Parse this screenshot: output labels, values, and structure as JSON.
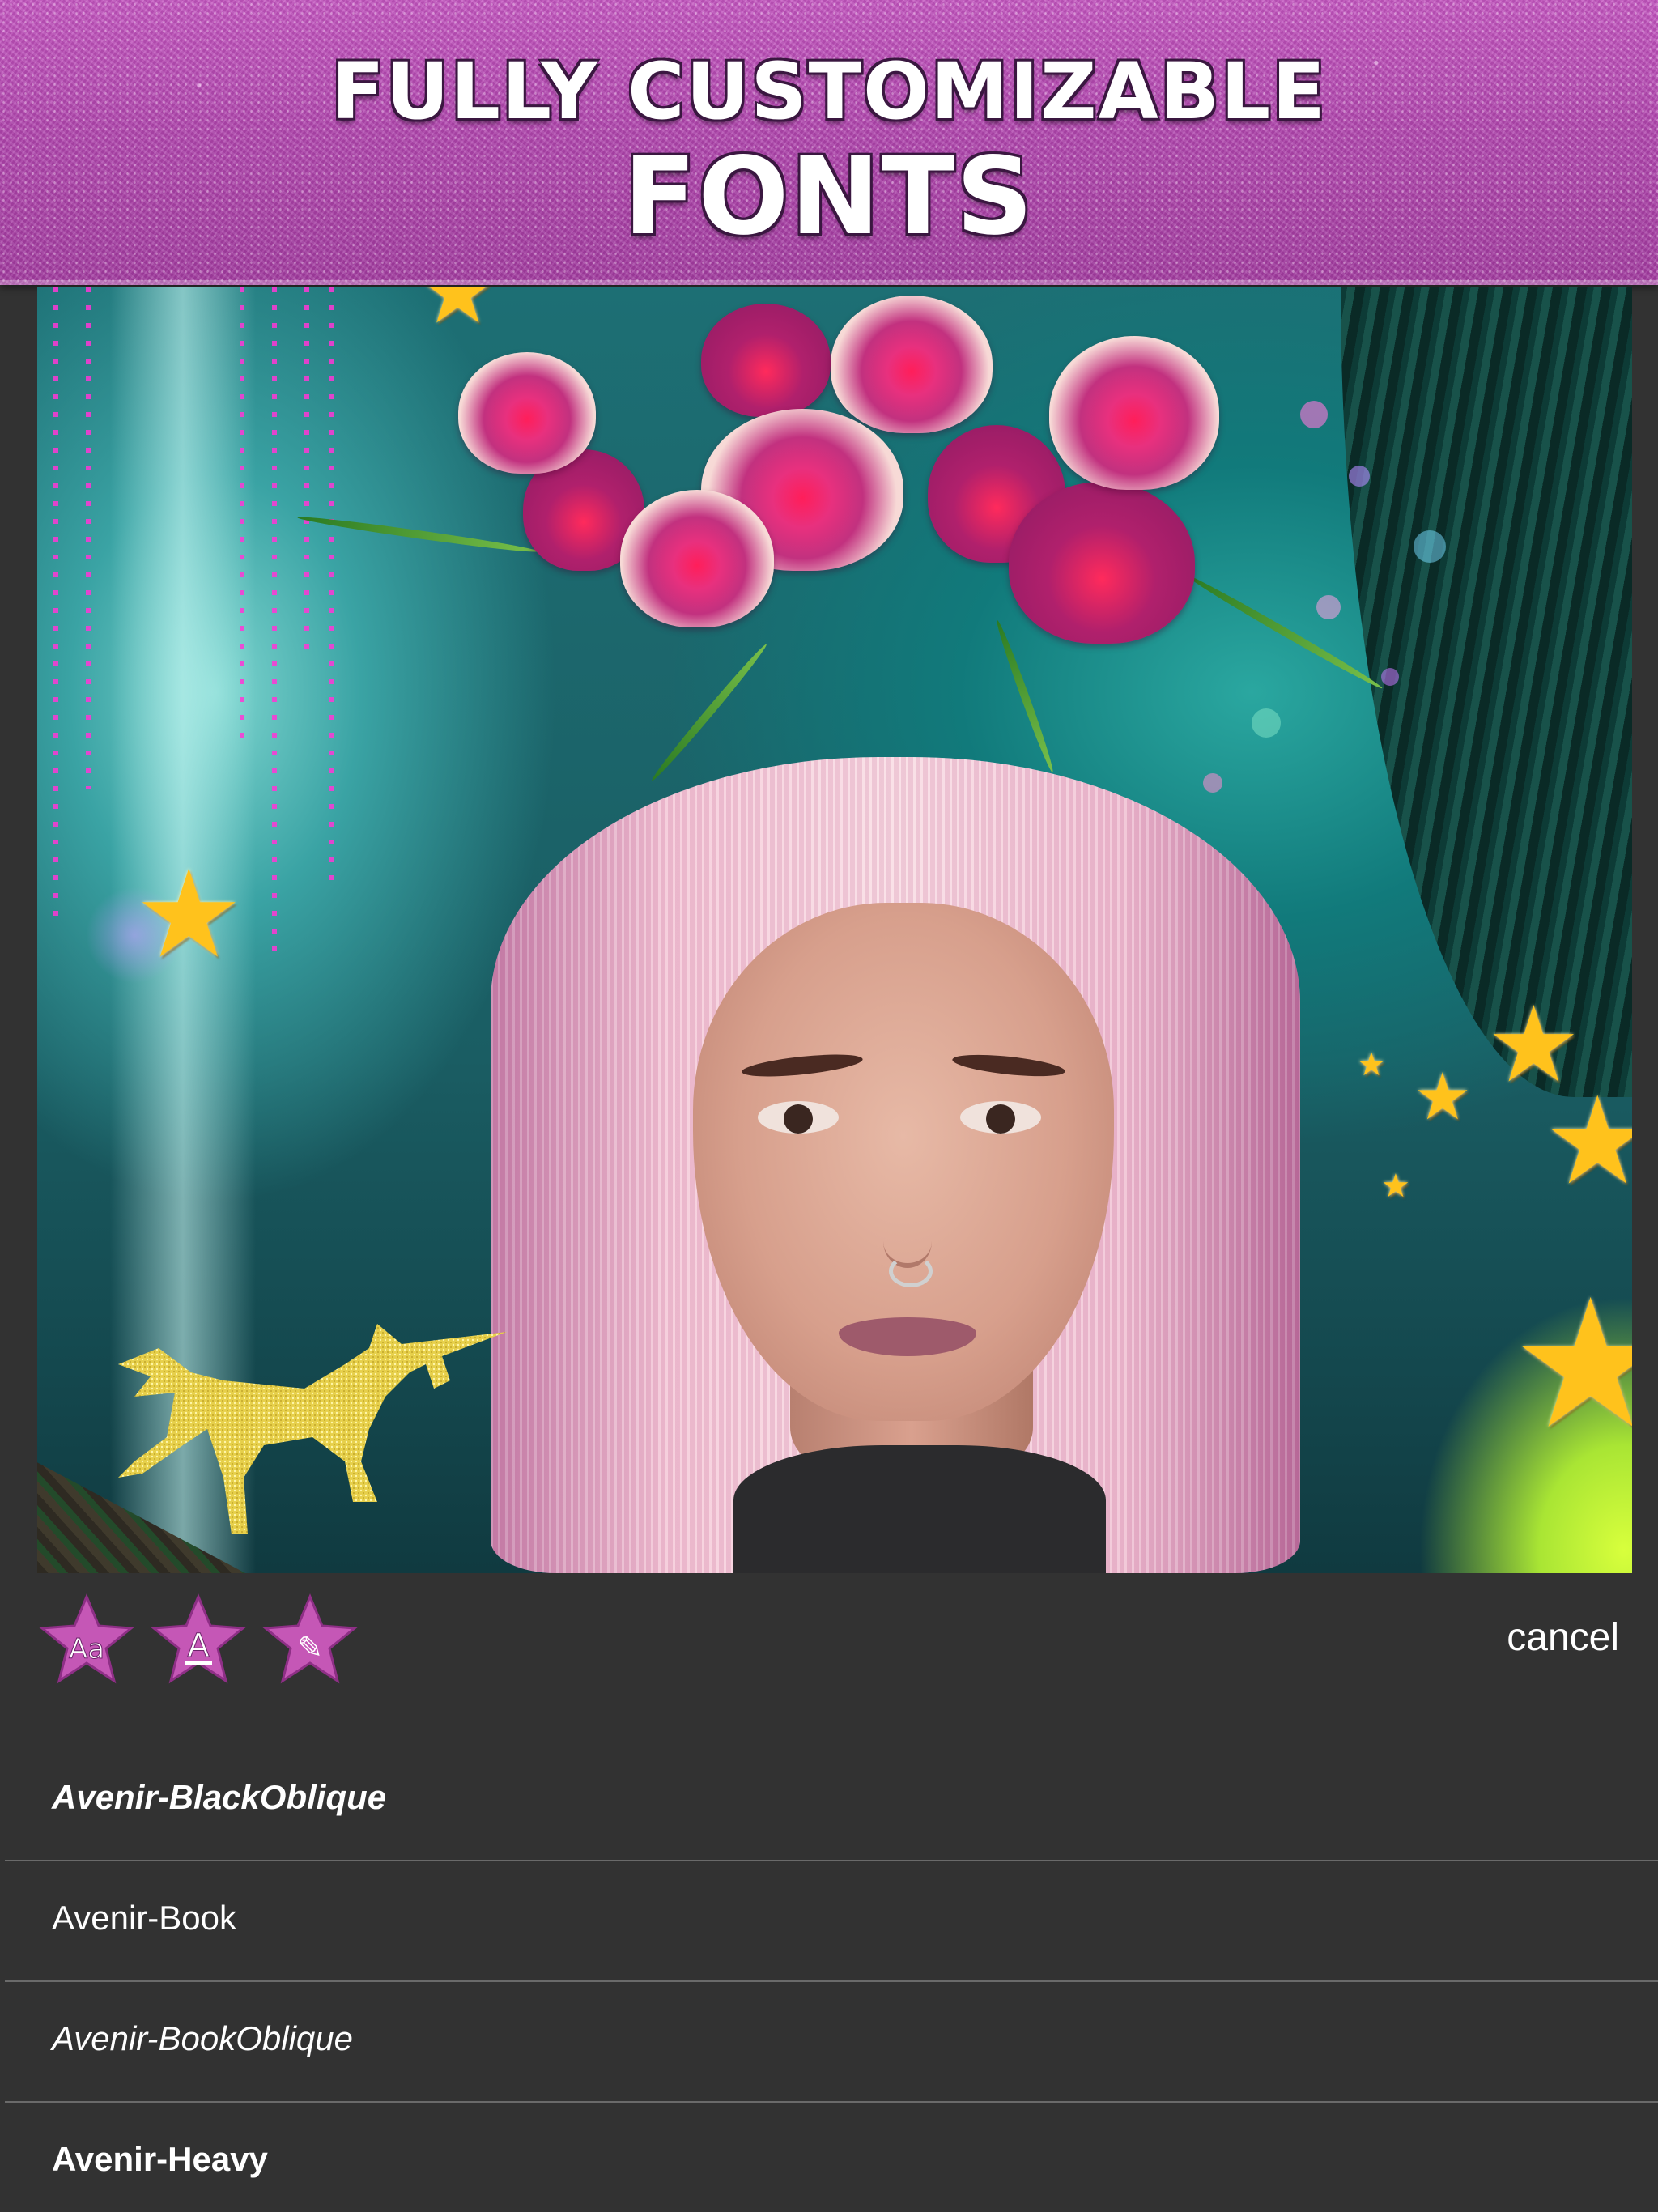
{
  "banner": {
    "line1": "FULLY CUSTOMIZABLE",
    "line2": "FONTS"
  },
  "colors": {
    "banner_purple": "#b04aae",
    "background": "#323232",
    "divider": "#6a6a6a",
    "text": "#ffffff",
    "tool_star": "#c557b6"
  },
  "toolbar": {
    "tools": [
      {
        "name": "font-style",
        "icon": "font-aa-star-icon",
        "glyph": "Aa"
      },
      {
        "name": "text-color",
        "icon": "text-color-star-icon",
        "glyph": "A"
      },
      {
        "name": "brush",
        "icon": "brush-star-icon",
        "glyph": "✎"
      }
    ],
    "cancel_label": "cancel"
  },
  "font_list": {
    "items": [
      {
        "label": "Avenir-BlackOblique",
        "selected": true
      },
      {
        "label": "Avenir-Book",
        "selected": false
      },
      {
        "label": "Avenir-BookOblique",
        "selected": false
      },
      {
        "label": "Avenir-Heavy",
        "selected": false
      }
    ]
  }
}
